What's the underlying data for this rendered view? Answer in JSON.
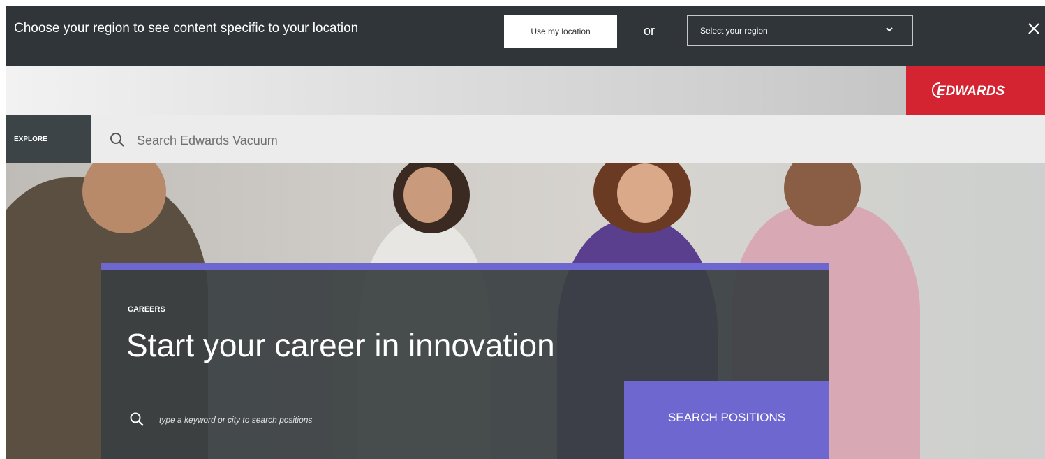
{
  "region_banner": {
    "message": "Choose your region to see content specific to your location",
    "use_location_label": "Use my location",
    "or_label": "or",
    "select_region_label": "Select your region"
  },
  "brand": {
    "logo_text": "EDWARDS",
    "logo_color": "#d42331"
  },
  "nav": {
    "explore_label": "EXPLORE",
    "search_placeholder": "Search Edwards Vacuum"
  },
  "hero": {
    "eyebrow": "CAREERS",
    "headline": "Start your career in innovation",
    "job_search_placeholder": "type a keyword or city to search positions",
    "search_button_label": "SEARCH POSITIONS",
    "accent_color": "#6d67cf"
  },
  "icons": [
    "chevron-down-icon",
    "close-icon",
    "search-icon"
  ]
}
